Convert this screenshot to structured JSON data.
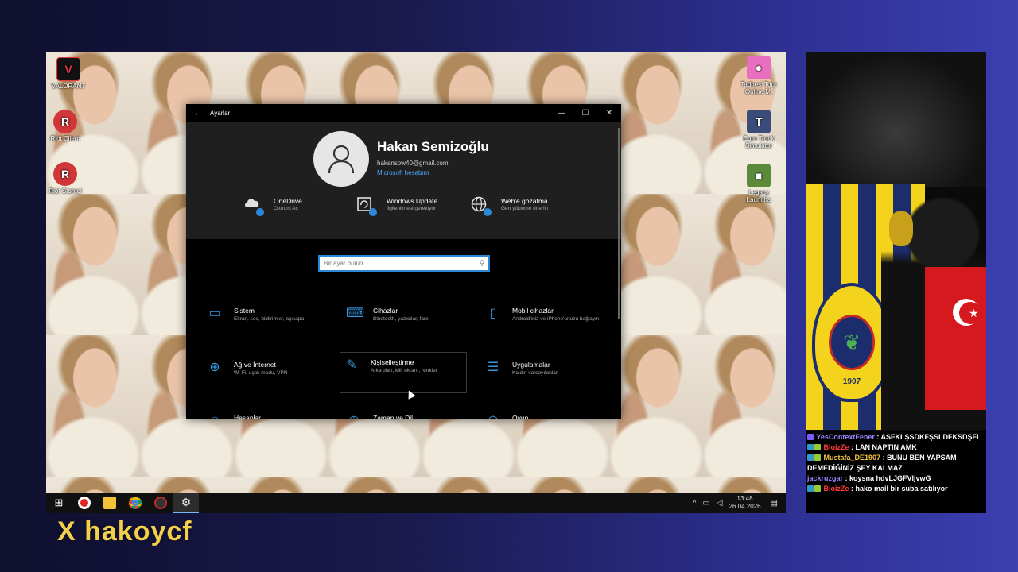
{
  "desktop": {
    "icons_left": [
      {
        "label": "VALORANT",
        "color": "#e0363c",
        "glyph": "V"
      },
      {
        "label": "Riot Client",
        "color": "#d13639",
        "glyph": "R"
      },
      {
        "label": "Riot Storeci",
        "color": "#d13639",
        "glyph": "R"
      }
    ],
    "icons_right": [
      {
        "label": "Tadhesi Tour Online M.",
        "color": "#e86fbf",
        "glyph": "●"
      },
      {
        "label": "Euro Truck Simulator",
        "color": "#3a4d7a",
        "glyph": "T"
      },
      {
        "label": "Legacy Launcha",
        "color": "#5b8a3a",
        "glyph": "■"
      }
    ]
  },
  "settings": {
    "title": "Ayarlar",
    "back": "←",
    "controls": {
      "minimize": "—",
      "maximize": "☐",
      "close": "✕"
    },
    "user": {
      "name": "Hakan Semizoğlu",
      "email": "hakansow40@gmail.com",
      "account_link": "Microsoft hesabım"
    },
    "quick": [
      {
        "title": "OneDrive",
        "subtitle": "Oturum Aç",
        "icon": "cloud-icon"
      },
      {
        "title": "Windows Update",
        "subtitle": "İlgilenilmesi gerekiyor",
        "icon": "update-icon"
      },
      {
        "title": "Web'e gözatma",
        "subtitle": "Gen yükleme önerilir",
        "icon": "globe-icon"
      }
    ],
    "search": {
      "placeholder": "Bir ayar bulun",
      "icon": "⚲"
    },
    "categories": [
      {
        "title": "Sistem",
        "subtitle": "Ekran, ses, bildirimler, açıkapa",
        "icon": "▭"
      },
      {
        "title": "Cihazlar",
        "subtitle": "Bluetooth, yazıcılar, fare",
        "icon": "⌨"
      },
      {
        "title": "Mobil cihazlar",
        "subtitle": "Android'iniz ve iPhone'unuzu bağlayın",
        "icon": "▯"
      },
      {
        "title": "Ağ ve İnternet",
        "subtitle": "Wi-Fi, uçak modu, VPN",
        "icon": "⊕"
      },
      {
        "title": "Kişiselleştirme",
        "subtitle": "Arka plan, kilit ekranı, renkler",
        "icon": "✎"
      },
      {
        "title": "Uygulamalar",
        "subtitle": "Kaldır, varsayılanlar",
        "icon": "☰"
      },
      {
        "title": "Hesaplar",
        "subtitle": "",
        "icon": "☺"
      },
      {
        "title": "Zaman ve Dil",
        "subtitle": "",
        "icon": "◷"
      },
      {
        "title": "Oyun",
        "subtitle": "",
        "icon": "◎"
      }
    ]
  },
  "taskbar": {
    "start": "⊞",
    "apps": [
      {
        "name": "media-player",
        "color": "#e02424"
      },
      {
        "name": "file-explorer",
        "color": "#f3c33a"
      },
      {
        "name": "chrome",
        "color": "#4caf50"
      },
      {
        "name": "record-app",
        "color": "#c62828"
      },
      {
        "name": "settings-app",
        "color": "#cccccc"
      }
    ],
    "tray": {
      "chevron": "^",
      "net": "▭",
      "speaker": "🔈",
      "vol": "◁",
      "time": "13:48",
      "date": "26.04.2026",
      "notify": "▤"
    }
  },
  "chat": [
    {
      "user": "YesContextFener",
      "user_color": "#9b86ff",
      "text": "ASFKLŞSDKFŞSLDFKSDŞFL",
      "badges": [
        "#7c5cff"
      ]
    },
    {
      "user": "BloizZe",
      "user_color": "#ff3b3b",
      "text": "LAN NAPTIN AMK",
      "badges": [
        "#39c",
        "#9c3"
      ]
    },
    {
      "user": "Mustafa_DE1907",
      "user_color": "#f5c542",
      "text": "BUNU BEN YAPSAM DEMEDİĞİNİZ ŞEY KALMAZ",
      "badges": [
        "#39c",
        "#9c3"
      ]
    },
    {
      "user": "jackruzgar",
      "user_color": "#9b86ff",
      "text": "koysna hdvLJGFVljvwG",
      "badges": []
    },
    {
      "user": "BloizZe",
      "user_color": "#ff3b3b",
      "text": "hako mail bir suba satılıyor",
      "badges": [
        "#39c",
        "#9c3"
      ]
    }
  ],
  "overlay": {
    "streamer": "X  hakoycf",
    "crest_year": "1907"
  }
}
